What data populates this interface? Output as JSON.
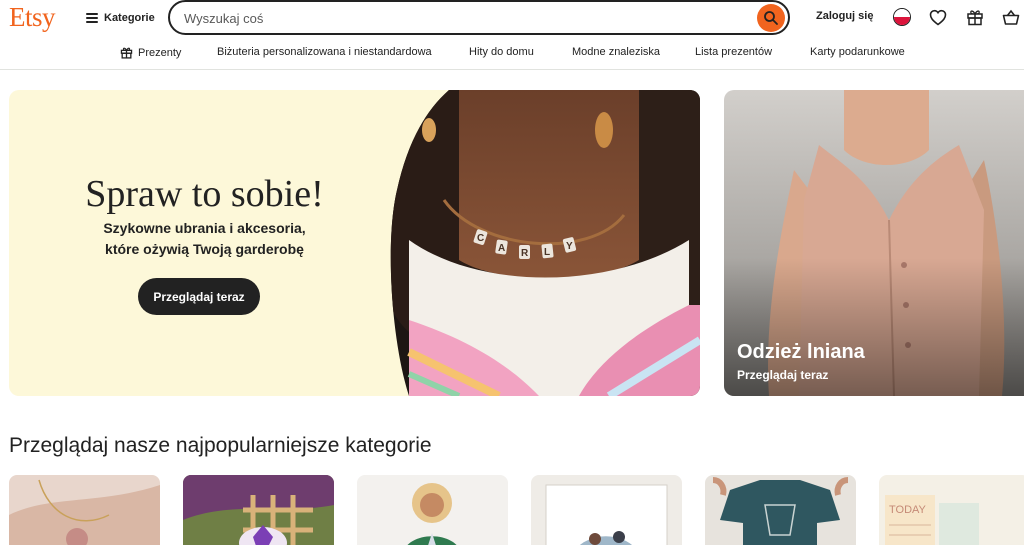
{
  "header": {
    "logo": "Etsy",
    "categories_label": "Kategorie",
    "search_placeholder": "Wyszukaj coś",
    "signin_label": "Zaloguj się"
  },
  "subnav": {
    "items": [
      "Prezenty",
      "Biżuteria personalizowana i niestandardowa",
      "Hity do domu",
      "Modne znaleziska",
      "Lista prezentów",
      "Karty podarunkowe"
    ]
  },
  "hero": {
    "title": "Spraw to sobie!",
    "subtitle": "Szykowne ubrania i akcesoria,\nktóre ożywią Twoją garderobę",
    "button": "Przeglądaj teraz",
    "necklace_text": "CARLY"
  },
  "side_card": {
    "title": "Odzież lniana",
    "link": "Przeglądaj teraz"
  },
  "popular": {
    "title": "Przeglądaj nasze najpopularniejsze kategorie",
    "planner_text": "TODAY"
  },
  "colors": {
    "brand": "#f1641e",
    "hero_bg": "#fdf8d9",
    "text": "#222222"
  }
}
